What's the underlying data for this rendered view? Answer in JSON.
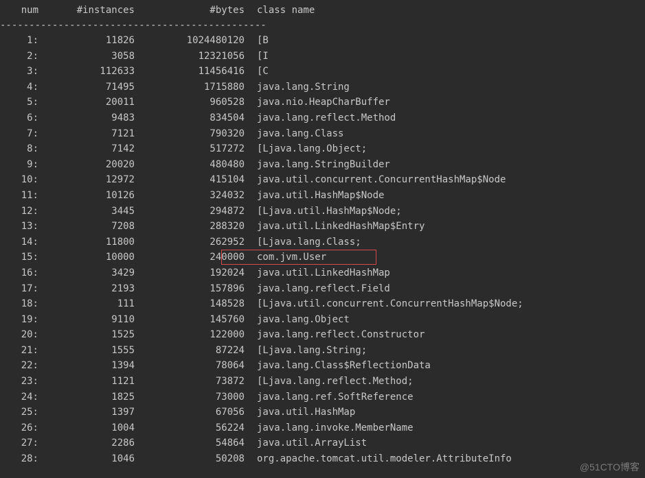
{
  "header": {
    "num": " num",
    "instances": "#instances",
    "bytes": "#bytes",
    "class_name": "class name"
  },
  "separator": "----------------------------------------------",
  "rows": [
    {
      "num": "1:",
      "instances": "11826",
      "bytes": "1024480120",
      "name": "[B"
    },
    {
      "num": "2:",
      "instances": "3058",
      "bytes": "12321056",
      "name": "[I"
    },
    {
      "num": "3:",
      "instances": "112633",
      "bytes": "11456416",
      "name": "[C"
    },
    {
      "num": "4:",
      "instances": "71495",
      "bytes": "1715880",
      "name": "java.lang.String"
    },
    {
      "num": "5:",
      "instances": "20011",
      "bytes": "960528",
      "name": "java.nio.HeapCharBuffer"
    },
    {
      "num": "6:",
      "instances": "9483",
      "bytes": "834504",
      "name": "java.lang.reflect.Method"
    },
    {
      "num": "7:",
      "instances": "7121",
      "bytes": "790320",
      "name": "java.lang.Class"
    },
    {
      "num": "8:",
      "instances": "7142",
      "bytes": "517272",
      "name": "[Ljava.lang.Object;"
    },
    {
      "num": "9:",
      "instances": "20020",
      "bytes": "480480",
      "name": "java.lang.StringBuilder"
    },
    {
      "num": "10:",
      "instances": "12972",
      "bytes": "415104",
      "name": "java.util.concurrent.ConcurrentHashMap$Node"
    },
    {
      "num": "11:",
      "instances": "10126",
      "bytes": "324032",
      "name": "java.util.HashMap$Node"
    },
    {
      "num": "12:",
      "instances": "3445",
      "bytes": "294872",
      "name": "[Ljava.util.HashMap$Node;"
    },
    {
      "num": "13:",
      "instances": "7208",
      "bytes": "288320",
      "name": "java.util.LinkedHashMap$Entry"
    },
    {
      "num": "14:",
      "instances": "11800",
      "bytes": "262952",
      "name": "[Ljava.lang.Class;"
    },
    {
      "num": "15:",
      "instances": "10000",
      "bytes": "240000",
      "name": "com.jvm.User",
      "highlight": true
    },
    {
      "num": "16:",
      "instances": "3429",
      "bytes": "192024",
      "name": "java.util.LinkedHashMap"
    },
    {
      "num": "17:",
      "instances": "2193",
      "bytes": "157896",
      "name": "java.lang.reflect.Field"
    },
    {
      "num": "18:",
      "instances": "111",
      "bytes": "148528",
      "name": "[Ljava.util.concurrent.ConcurrentHashMap$Node;"
    },
    {
      "num": "19:",
      "instances": "9110",
      "bytes": "145760",
      "name": "java.lang.Object"
    },
    {
      "num": "20:",
      "instances": "1525",
      "bytes": "122000",
      "name": "java.lang.reflect.Constructor"
    },
    {
      "num": "21:",
      "instances": "1555",
      "bytes": "87224",
      "name": "[Ljava.lang.String;"
    },
    {
      "num": "22:",
      "instances": "1394",
      "bytes": "78064",
      "name": "java.lang.Class$ReflectionData"
    },
    {
      "num": "23:",
      "instances": "1121",
      "bytes": "73872",
      "name": "[Ljava.lang.reflect.Method;"
    },
    {
      "num": "24:",
      "instances": "1825",
      "bytes": "73000",
      "name": "java.lang.ref.SoftReference"
    },
    {
      "num": "25:",
      "instances": "1397",
      "bytes": "67056",
      "name": "java.util.HashMap"
    },
    {
      "num": "26:",
      "instances": "1004",
      "bytes": "56224",
      "name": "java.lang.invoke.MemberName"
    },
    {
      "num": "27:",
      "instances": "2286",
      "bytes": "54864",
      "name": "java.util.ArrayList"
    },
    {
      "num": "28:",
      "instances": "1046",
      "bytes": "50208",
      "name": "org.apache.tomcat.util.modeler.AttributeInfo"
    }
  ],
  "watermark": "@51CTO博客"
}
